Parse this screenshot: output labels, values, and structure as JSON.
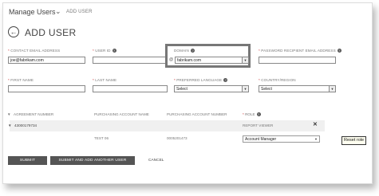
{
  "breadcrumb": {
    "title": "Manage Users",
    "chevron": "⌄",
    "current": "ADD USER"
  },
  "page_title": "ADD USER",
  "fields": {
    "contact_email": {
      "label": "CONTACT EMAIL ADDRESS",
      "value": "joe@fabrikam.com"
    },
    "user_id": {
      "label": "USER ID",
      "value": ""
    },
    "domain": {
      "label": "DOMAIN",
      "value": "fabrikam.com"
    },
    "password_email": {
      "label": "PASSWORD RECIPIENT EMAIL ADDRESS",
      "value": ""
    },
    "first_name": {
      "label": "FIRST NAME",
      "value": ""
    },
    "last_name": {
      "label": "LAST NAME",
      "value": ""
    },
    "preferred_language": {
      "label": "PREFERRED LANGUAGE",
      "value": "Select"
    },
    "country_region": {
      "label": "COUNTRY/REGION",
      "value": "Select"
    }
  },
  "table": {
    "headers": [
      "AGREEMENT NUMBER",
      "PURCHASING ACCOUNT NAME",
      "PURCHASING ACCOUNT NUMBER",
      "ROLE"
    ],
    "group_row": {
      "agreement": "43000179734",
      "role": "REPORT VIEWER"
    },
    "detail_row": {
      "account_name": "TEST 06",
      "account_number": "0005201473",
      "role_value": "Account Manager"
    }
  },
  "tooltip": "Reset role",
  "buttons": {
    "submit": "SUBMIT",
    "submit_add_another": "SUBMIT AND ADD ANOTHER USER",
    "cancel": "CANCEL"
  }
}
